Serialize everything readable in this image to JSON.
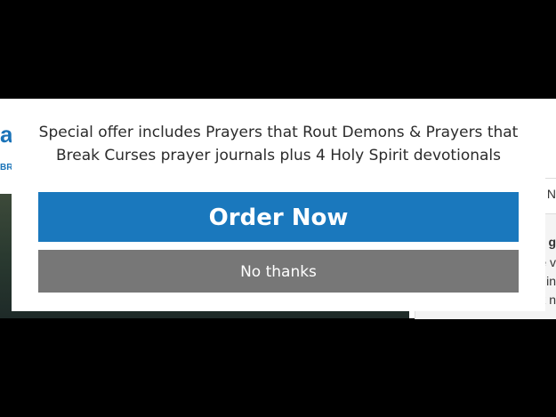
{
  "modal": {
    "offer_text": "Special offer includes Prayers that Rout Demons & Prayers that Break Curses prayer journals plus 4 Holy Spirit devotionals",
    "order_label": "Order Now",
    "nothanks_label": "No thanks"
  },
  "background": {
    "left_letter": "a",
    "left_small": "BR",
    "right_items": [
      "N",
      "g",
      "e v",
      "in",
      "k n"
    ]
  },
  "colors": {
    "order_button": "#1a78bd",
    "nothanks_button": "#777777",
    "overlay": "#000000"
  }
}
